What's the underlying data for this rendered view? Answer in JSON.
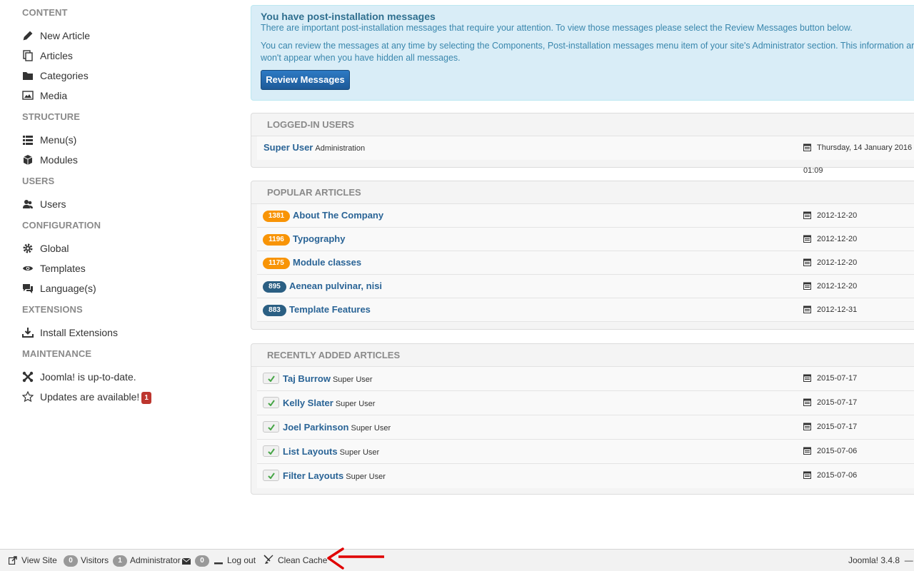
{
  "sidebar": {
    "sections": [
      {
        "title": "CONTENT",
        "items": [
          {
            "label": "New Article",
            "icon": "pencil-icon"
          },
          {
            "label": "Articles",
            "icon": "copy-icon"
          },
          {
            "label": "Categories",
            "icon": "folder-icon"
          },
          {
            "label": "Media",
            "icon": "image-icon"
          }
        ]
      },
      {
        "title": "STRUCTURE",
        "items": [
          {
            "label": "Menu(s)",
            "icon": "list-icon"
          },
          {
            "label": "Modules",
            "icon": "cube-icon"
          }
        ]
      },
      {
        "title": "USERS",
        "items": [
          {
            "label": "Users",
            "icon": "users-icon"
          }
        ]
      },
      {
        "title": "CONFIGURATION",
        "items": [
          {
            "label": "Global",
            "icon": "cog-icon"
          },
          {
            "label": "Templates",
            "icon": "eye-icon"
          },
          {
            "label": "Language(s)",
            "icon": "comments-icon"
          }
        ]
      },
      {
        "title": "EXTENSIONS",
        "items": [
          {
            "label": "Install Extensions",
            "icon": "download-icon"
          }
        ]
      },
      {
        "title": "MAINTENANCE",
        "items": [
          {
            "label": "Joomla! is up-to-date.",
            "icon": "joomla-icon"
          },
          {
            "label": "Updates are available!",
            "icon": "star-icon",
            "badge": "1"
          }
        ]
      }
    ]
  },
  "alert": {
    "title": "You have post-installation messages",
    "line1": "There are important post-installation messages that require your attention. To view those messages please select the Review Messages button below.",
    "line2": "You can review the messages at any time by selecting the Components, Post-installation messages menu item of your site's Administrator section. This information area won't appear when you have hidden all messages.",
    "button": "Review Messages"
  },
  "logged_in": {
    "title": "LOGGED-IN USERS",
    "rows": [
      {
        "name": "Super User",
        "sub": "Administration",
        "date": "Thursday, 14 January 2016 01:09"
      }
    ]
  },
  "popular": {
    "title": "POPULAR ARTICLES",
    "rows": [
      {
        "hits": "1381",
        "title": "About The Company",
        "date": "2012-12-20",
        "color": "#f89406"
      },
      {
        "hits": "1196",
        "title": "Typography",
        "date": "2012-12-20",
        "color": "#f89406"
      },
      {
        "hits": "1175",
        "title": "Module classes",
        "date": "2012-12-20",
        "color": "#f89406"
      },
      {
        "hits": "895",
        "title": "Aenean pulvinar, nisi",
        "date": "2012-12-20",
        "color": "#2b5f83"
      },
      {
        "hits": "883",
        "title": "Template Features",
        "date": "2012-12-31",
        "color": "#2b5f83"
      }
    ]
  },
  "recent": {
    "title": "RECENTLY ADDED ARTICLES",
    "rows": [
      {
        "title": "Taj Burrow",
        "author": "Super User",
        "date": "2015-07-17"
      },
      {
        "title": "Kelly Slater",
        "author": "Super User",
        "date": "2015-07-17"
      },
      {
        "title": "Joel Parkinson",
        "author": "Super User",
        "date": "2015-07-17"
      },
      {
        "title": "List Layouts",
        "author": "Super User",
        "date": "2015-07-06"
      },
      {
        "title": "Filter Layouts",
        "author": "Super User",
        "date": "2015-07-06"
      }
    ]
  },
  "statusbar": {
    "view_site": "View Site",
    "visitors_count": "0",
    "visitors_label": "Visitors",
    "admin_count": "1",
    "admin_label": "Administrator",
    "messages_count": "0",
    "logout": "Log out",
    "clean_cache": "Clean Cache",
    "version": "Joomla! 3.4.8",
    "version_suffix": "—"
  },
  "colors": {
    "link": "#2a6496",
    "alert_bg": "#d9edf7",
    "badge_orange": "#f89406",
    "badge_blue": "#2b5f83",
    "arrow": "#e00000"
  }
}
